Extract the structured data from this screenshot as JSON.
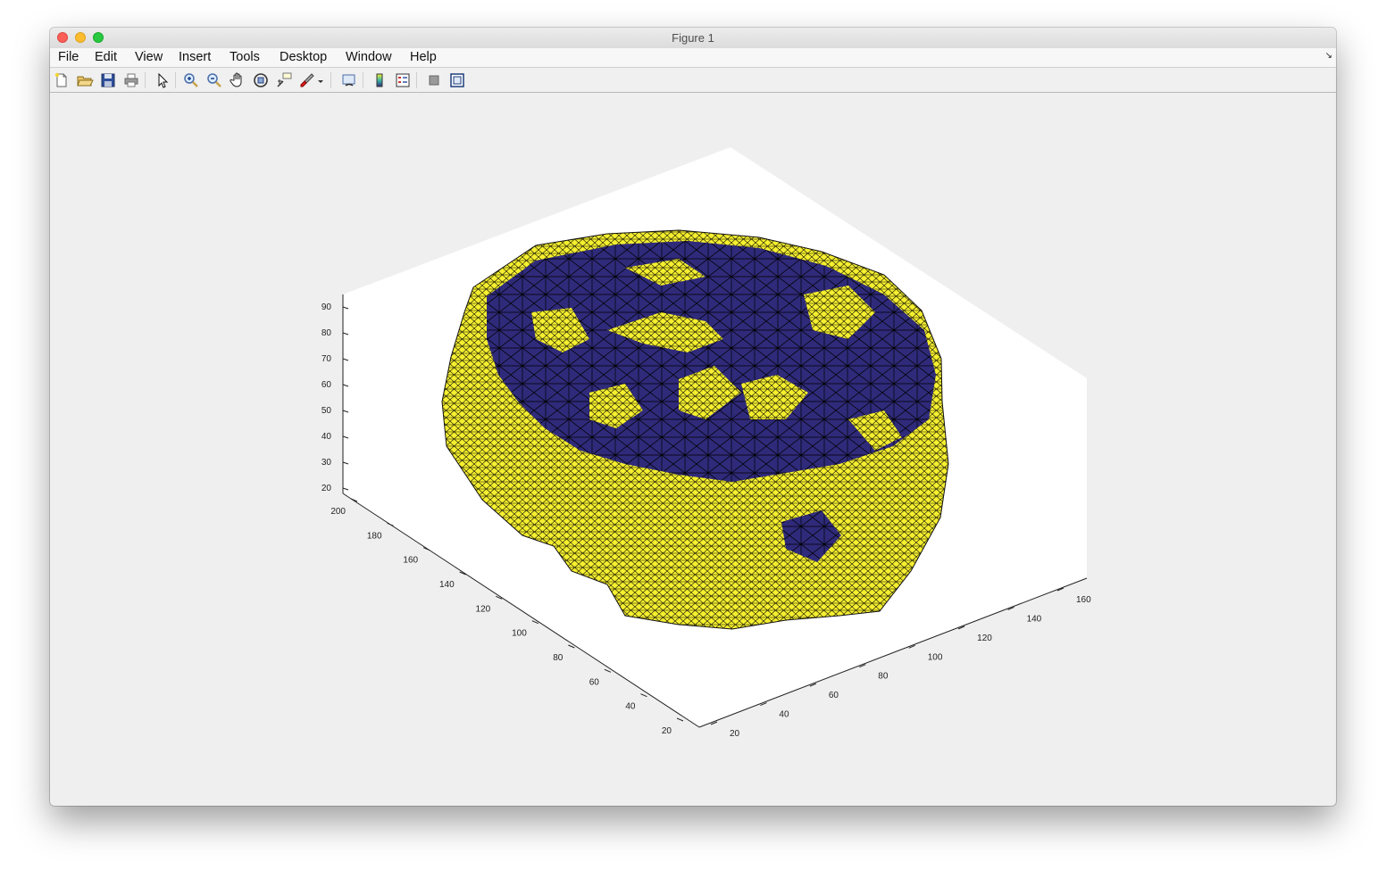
{
  "window": {
    "title": "Figure 1"
  },
  "menu": [
    "File",
    "Edit",
    "View",
    "Insert",
    "Tools",
    "Desktop",
    "Window",
    "Help"
  ],
  "toolbar": [
    "new-figure-icon",
    "open-file-icon",
    "save-figure-icon",
    "print-figure-icon",
    "edit-plot-icon",
    "zoom-in-icon",
    "zoom-out-icon",
    "pan-icon",
    "rotate-3d-icon",
    "data-cursor-icon",
    "brush-icon",
    "brush-dropdown-icon",
    "link-plot-icon",
    "insert-colorbar-icon",
    "insert-legend-icon",
    "hide-plot-tools-icon",
    "show-plot-tools-icon"
  ],
  "colors": {
    "surface": "#f5ef2f",
    "surface_inner": "#2f2a7a",
    "edges": "#000000",
    "axes_background": "#ffffff"
  },
  "chart_data": {
    "type": "surface",
    "view": "3d",
    "title": "",
    "xlabel": "",
    "ylabel": "",
    "zlabel": "",
    "x_ticks": [
      20,
      40,
      60,
      80,
      100,
      120,
      140,
      160
    ],
    "y_ticks": [
      20,
      40,
      60,
      80,
      100,
      120,
      140,
      160,
      180,
      200
    ],
    "z_ticks": [
      20,
      30,
      40,
      50,
      60,
      70,
      80,
      90
    ],
    "grid": false,
    "legend": null
  }
}
